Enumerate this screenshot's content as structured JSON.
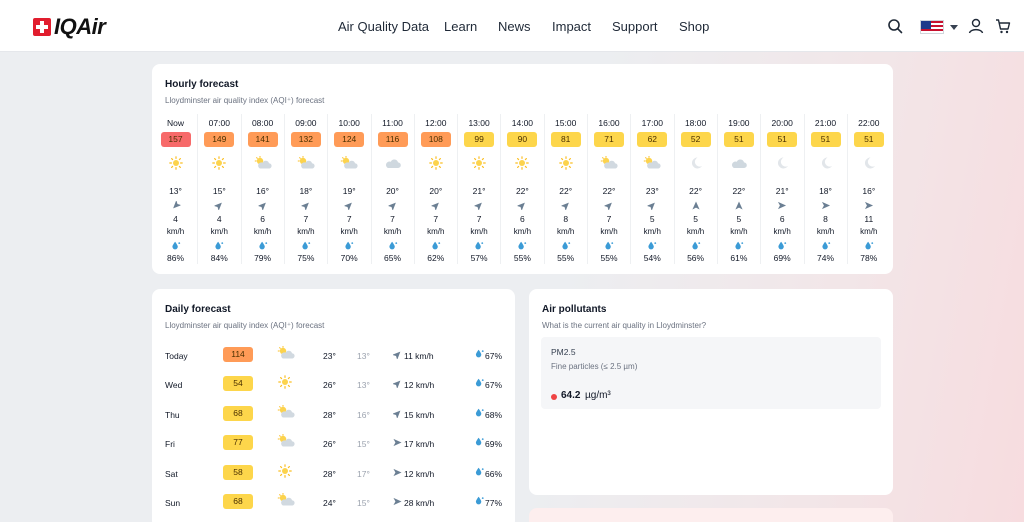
{
  "brand": {
    "name": "IQAir"
  },
  "nav": [
    "Air Quality Data",
    "Learn",
    "News",
    "Impact",
    "Support",
    "Shop"
  ],
  "header_icons": [
    "search-icon",
    "us-flag-icon",
    "user-icon",
    "cart-icon"
  ],
  "hourly": {
    "title": "Hourly forecast",
    "subtitle": "Lloydminster air quality index (AQI⁺) forecast",
    "unit": "km/h",
    "hours": [
      {
        "time": "Now",
        "aqi": "157",
        "level": "red",
        "icon": "sun",
        "temp": "13°",
        "wind": "4",
        "dir": "sw",
        "hum": "86%"
      },
      {
        "time": "07:00",
        "aqi": "149",
        "level": "orange",
        "icon": "sun",
        "temp": "15°",
        "wind": "4",
        "dir": "ne",
        "hum": "84%"
      },
      {
        "time": "08:00",
        "aqi": "141",
        "level": "orange",
        "icon": "partly-sun",
        "temp": "16°",
        "wind": "6",
        "dir": "ne",
        "hum": "79%"
      },
      {
        "time": "09:00",
        "aqi": "132",
        "level": "orange",
        "icon": "partly-sun",
        "temp": "18°",
        "wind": "7",
        "dir": "ne",
        "hum": "75%"
      },
      {
        "time": "10:00",
        "aqi": "124",
        "level": "orange",
        "icon": "partly-sun",
        "temp": "19°",
        "wind": "7",
        "dir": "ne",
        "hum": "70%"
      },
      {
        "time": "11:00",
        "aqi": "116",
        "level": "orange",
        "icon": "cloud",
        "temp": "20°",
        "wind": "7",
        "dir": "ne",
        "hum": "65%"
      },
      {
        "time": "12:00",
        "aqi": "108",
        "level": "orange",
        "icon": "sun",
        "temp": "20°",
        "wind": "7",
        "dir": "ne",
        "hum": "62%"
      },
      {
        "time": "13:00",
        "aqi": "99",
        "level": "yellow",
        "icon": "sun",
        "temp": "21°",
        "wind": "7",
        "dir": "ne",
        "hum": "57%"
      },
      {
        "time": "14:00",
        "aqi": "90",
        "level": "yellow",
        "icon": "sun",
        "temp": "22°",
        "wind": "6",
        "dir": "ne",
        "hum": "55%"
      },
      {
        "time": "15:00",
        "aqi": "81",
        "level": "yellow",
        "icon": "sun",
        "temp": "22°",
        "wind": "8",
        "dir": "ne",
        "hum": "55%"
      },
      {
        "time": "16:00",
        "aqi": "71",
        "level": "yellow",
        "icon": "partly-sun",
        "temp": "22°",
        "wind": "7",
        "dir": "ne",
        "hum": "55%"
      },
      {
        "time": "17:00",
        "aqi": "62",
        "level": "yellow",
        "icon": "partly-sun",
        "temp": "23°",
        "wind": "5",
        "dir": "ne",
        "hum": "54%"
      },
      {
        "time": "18:00",
        "aqi": "52",
        "level": "yellow",
        "icon": "moon",
        "temp": "22°",
        "wind": "5",
        "dir": "n",
        "hum": "56%"
      },
      {
        "time": "19:00",
        "aqi": "51",
        "level": "yellow",
        "icon": "cloud",
        "temp": "22°",
        "wind": "5",
        "dir": "n",
        "hum": "61%"
      },
      {
        "time": "20:00",
        "aqi": "51",
        "level": "yellow",
        "icon": "moon",
        "temp": "21°",
        "wind": "6",
        "dir": "e",
        "hum": "69%"
      },
      {
        "time": "21:00",
        "aqi": "51",
        "level": "yellow",
        "icon": "moon",
        "temp": "18°",
        "wind": "8",
        "dir": "e",
        "hum": "74%"
      },
      {
        "time": "22:00",
        "aqi": "51",
        "level": "yellow",
        "icon": "moon",
        "temp": "16°",
        "wind": "11",
        "dir": "e",
        "hum": "78%"
      }
    ]
  },
  "daily": {
    "title": "Daily forecast",
    "subtitle": "Lloydminster air quality index (AQI⁺) forecast",
    "days": [
      {
        "day": "Today",
        "aqi": "114",
        "level": "orange",
        "icon": "partly-sun",
        "hi": "23°",
        "lo": "13°",
        "wind": "11 km/h",
        "dir": "ne",
        "hum": "67%"
      },
      {
        "day": "Wed",
        "aqi": "54",
        "level": "yellow",
        "icon": "sun",
        "hi": "26°",
        "lo": "13°",
        "wind": "12 km/h",
        "dir": "ne",
        "hum": "67%"
      },
      {
        "day": "Thu",
        "aqi": "68",
        "level": "yellow",
        "icon": "partly-sun",
        "hi": "28°",
        "lo": "16°",
        "wind": "15 km/h",
        "dir": "ne",
        "hum": "68%"
      },
      {
        "day": "Fri",
        "aqi": "77",
        "level": "yellow",
        "icon": "partly-sun",
        "hi": "26°",
        "lo": "15°",
        "wind": "17 km/h",
        "dir": "e",
        "hum": "69%"
      },
      {
        "day": "Sat",
        "aqi": "58",
        "level": "yellow",
        "icon": "sun",
        "hi": "28°",
        "lo": "17°",
        "wind": "12 km/h",
        "dir": "e",
        "hum": "66%"
      },
      {
        "day": "Sun",
        "aqi": "68",
        "level": "yellow",
        "icon": "partly-sun",
        "hi": "24°",
        "lo": "15°",
        "wind": "28 km/h",
        "dir": "e",
        "hum": "77%"
      }
    ]
  },
  "pollutants": {
    "title": "Air pollutants",
    "subtitle": "What is the current air quality in Lloydminster?",
    "item": {
      "name": "PM2.5",
      "desc": "Fine particles (≤ 2.5 µm)",
      "value": "64.2",
      "unit": "µg/m³"
    }
  },
  "colors": {
    "red": "#f76a6a",
    "orange": "#ff9b57",
    "yellow": "#fdd64b",
    "accent_red": "#e11d2e"
  }
}
